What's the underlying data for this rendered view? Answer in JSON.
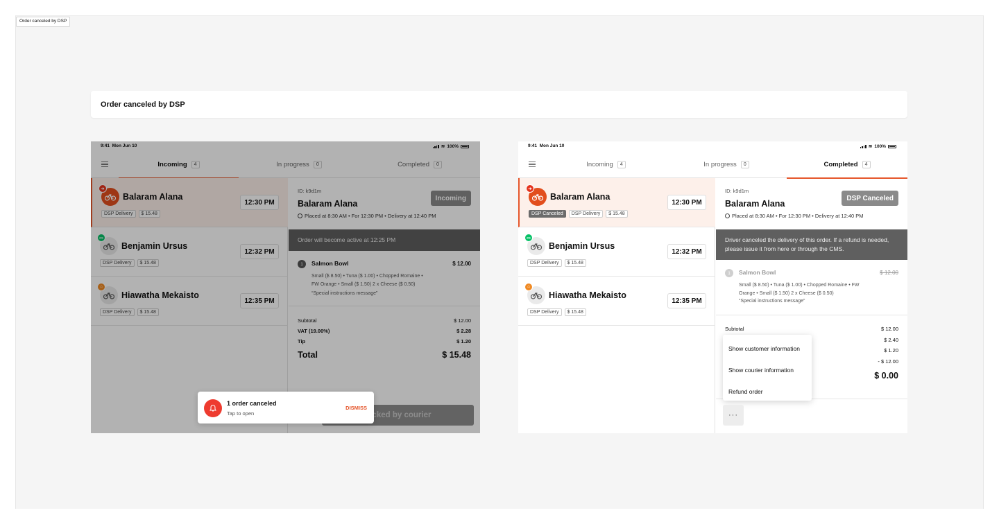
{
  "frame_label": "Order canceled by DSP",
  "header_title": "Order canceled by DSP",
  "status_bar": {
    "time": "9:41",
    "date": "Mon Jun 10",
    "battery": "100%"
  },
  "orders": [
    {
      "name": "Balaram Alana",
      "time": "12:30 PM",
      "delivery": "DSP Delivery",
      "amount": "$ 15.48",
      "icon": "bicycle-icon",
      "platform_icon": "doordash-icon",
      "platform_color": "#e5341e"
    },
    {
      "name": "Benjamin Ursus",
      "time": "12:32 PM",
      "delivery": "DSP Delivery",
      "amount": "$ 15.48",
      "icon": "bicycle-icon",
      "platform_icon": "uber-eats-icon",
      "platform_color": "#06c167"
    },
    {
      "name": "Hiawatha Mekaisto",
      "time": "12:35 PM",
      "delivery": "DSP Delivery",
      "amount": "$ 15.48",
      "icon": "bicycle-icon",
      "platform_icon": "store-icon",
      "platform_color": "#f08a24"
    }
  ],
  "left": {
    "tabs": [
      {
        "label": "Incoming",
        "count": "4"
      },
      {
        "label": "In progress",
        "count": "0"
      },
      {
        "label": "Completed",
        "count": "0"
      }
    ],
    "detail": {
      "id": "ID: k9d1m",
      "name": "Balaram Alana",
      "placed": "Placed at 8:30 AM • For 12:30 PM • Delivery at 12:40 PM",
      "status": "Incoming",
      "notice": "Order will become active at 12:25 PM",
      "item": {
        "num": "1",
        "name": "Salmon Bowl",
        "price": "$ 12.00",
        "mods_1": "Small ($ 8.50) • Tuna ($ 1.00) • Chopped Romaine •",
        "mods_2": "FW Orange • Small ($ 1.50) 2 x Cheese ($ 0.50)",
        "note": "“Special instructions message”"
      },
      "summary": [
        {
          "label": "Subtotal",
          "value": "$ 12.00"
        },
        {
          "label": "VAT (19.00%)",
          "value": "$ 2.28"
        },
        {
          "label": "Tip",
          "value": "$ 1.20"
        }
      ],
      "total_label": "Total",
      "total_value": "$ 15.48",
      "footer_button": "Picked by courier"
    },
    "toast": {
      "title": "1 order canceled",
      "subtitle": "Tap to open",
      "action": "DISMISS"
    }
  },
  "right": {
    "tabs": [
      {
        "label": "Incoming",
        "count": "4"
      },
      {
        "label": "In progress",
        "count": "0"
      },
      {
        "label": "Completed",
        "count": "4"
      }
    ],
    "canceled_tag": "DSP Canceled",
    "detail": {
      "id": "ID: k9d1m",
      "name": "Balaram Alana",
      "placed": "Placed at 8:30 AM • For 12:30 PM • Delivery at 12:40 PM",
      "status": "DSP Canceled",
      "notice": "Driver canceled the delivery of this order. If a refund is needed, please issue it from here or through the CMS.",
      "item": {
        "num": "1",
        "name": "Salmon Bowl",
        "price": "$ 12.00",
        "mods_1": "Small ($ 8.50) • Tuna ($ 1.00) • Chopped Romaine • FW",
        "mods_2": "Orange • Small ($ 1.50) 2 x Cheese ($ 0.50)",
        "note": "“Special instructions message”"
      },
      "subtotal_label": "Subtotal",
      "values": [
        "$ 12.00",
        "$ 2.40",
        "$ 1.20",
        "- $ 12.00"
      ],
      "total_value": "$ 0.00",
      "menu": [
        "Show customer information",
        "Show courier information",
        "Refund order"
      ],
      "more_label": "···"
    }
  }
}
